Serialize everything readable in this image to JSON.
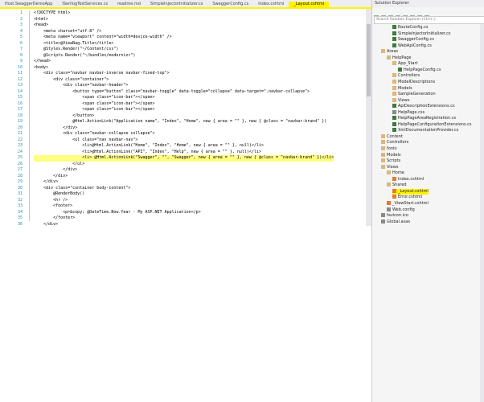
{
  "tabs": [
    "Host.SwaggerDemoApp",
    "ISerilogTestServices.cs",
    "readme.md",
    "SimpleInjectorInitializer.cs",
    "SwaggerConfig.cs",
    "Index.cshtml",
    "_Layout.cshtml"
  ],
  "active_tab": "_Layout.cshtml",
  "code": [
    {
      "n": "1",
      "t": "<!DOCTYPE html>"
    },
    {
      "n": "2",
      "t": "<html>"
    },
    {
      "n": "3",
      "t": "<head>"
    },
    {
      "n": "4",
      "t": "    <meta charset=\"utf-8\" />"
    },
    {
      "n": "5",
      "t": "    <meta name=\"viewport\" content=\"width=device-width\" />"
    },
    {
      "n": "6",
      "t": "    <title>@ViewBag.Title</title>"
    },
    {
      "n": "7",
      "t": "    @Styles.Render(\"~/Content/css\")"
    },
    {
      "n": "8",
      "t": "    @Scripts.Render(\"~/bundles/modernizr\")"
    },
    {
      "n": "9",
      "t": "</head>"
    },
    {
      "n": "10",
      "t": "<body>"
    },
    {
      "n": "11",
      "t": "    <div class=\"navbar navbar-inverse navbar-fixed-top\">"
    },
    {
      "n": "12",
      "t": "        <div class=\"container\">"
    },
    {
      "n": "13",
      "t": "            <div class=\"navbar-header\">"
    },
    {
      "n": "14",
      "t": "                <button type=\"button\" class=\"navbar-toggle\" data-toggle=\"collapse\" data-target=\".navbar-collapse\">"
    },
    {
      "n": "15",
      "t": "                    <span class=\"icon-bar\"></span>"
    },
    {
      "n": "16",
      "t": "                    <span class=\"icon-bar\"></span>"
    },
    {
      "n": "17",
      "t": "                    <span class=\"icon-bar\"></span>"
    },
    {
      "n": "18",
      "t": "                </button>"
    },
    {
      "n": "19",
      "t": "                @Html.ActionLink(\"Application name\", \"Index\", \"Home\", new { area = \"\" }, new { @class = \"navbar-brand\" })"
    },
    {
      "n": "20",
      "t": "            </div>"
    },
    {
      "n": "21",
      "t": "            <div class=\"navbar-collapse collapse\">"
    },
    {
      "n": "22",
      "t": "                <ul class=\"nav navbar-nav\">"
    },
    {
      "n": "23",
      "t": "                    <li>@Html.ActionLink(\"Home\", \"Index\", \"Home\", new { area = \"\" }, null)</li>"
    },
    {
      "n": "24",
      "t": "                    <li>@Html.ActionLink(\"API\", \"Index\", \"Help\", new { area = \"\" }, null)</li>"
    },
    {
      "n": "25",
      "t": "                    <li> @Html.ActionLink(\"Swagger\", \"\", \"Swagger\", new { area = \"\" }, new { @class = \"navbar-brand\" })</li>",
      "hl": true
    },
    {
      "n": "26",
      "t": "                </ul>"
    },
    {
      "n": "27",
      "t": "            </div>"
    },
    {
      "n": "28",
      "t": "        </div>"
    },
    {
      "n": "29",
      "t": "    </div>"
    },
    {
      "n": "30",
      "t": "    <div class=\"container body-content\">"
    },
    {
      "n": "31",
      "t": "        @RenderBody()"
    },
    {
      "n": "32",
      "t": "        <hr />"
    },
    {
      "n": "33",
      "t": "        <footer>"
    },
    {
      "n": "34",
      "t": "            <p>&copy; @DateTime.Now.Year - My ASP.NET Application</p>"
    },
    {
      "n": "35",
      "t": "        </footer>"
    },
    {
      "n": "36",
      "t": "    </div>"
    }
  ],
  "solution_explorer": {
    "title": "Solution Explorer",
    "search_placeholder": "Search Solution Explorer (Ctrl+;)",
    "items": [
      {
        "label": "RouteConfig.cs",
        "icon": "cs",
        "indent": 3
      },
      {
        "label": "SimpleInjectorInitializer.cs",
        "icon": "cs",
        "indent": 3
      },
      {
        "label": "SwaggerConfig.cs",
        "icon": "cs",
        "indent": 3
      },
      {
        "label": "WebApiConfig.cs",
        "icon": "cs",
        "indent": 3
      },
      {
        "label": "Areas",
        "icon": "folder",
        "indent": 1
      },
      {
        "label": "HelpPage",
        "icon": "folder",
        "indent": 2
      },
      {
        "label": "App_Start",
        "icon": "folder",
        "indent": 3
      },
      {
        "label": "HelpPageConfig.cs",
        "icon": "cs",
        "indent": 4
      },
      {
        "label": "Controllers",
        "icon": "folder",
        "indent": 3
      },
      {
        "label": "ModelDescriptions",
        "icon": "folder",
        "indent": 3
      },
      {
        "label": "Models",
        "icon": "folder",
        "indent": 3
      },
      {
        "label": "SampleGeneration",
        "icon": "folder",
        "indent": 3
      },
      {
        "label": "Views",
        "icon": "folder",
        "indent": 3
      },
      {
        "label": "ApiDescriptionExtensions.cs",
        "icon": "cs",
        "indent": 3
      },
      {
        "label": "HelpPage.css",
        "icon": "file",
        "indent": 3
      },
      {
        "label": "HelpPageAreaRegistration.cs",
        "icon": "cs",
        "indent": 3
      },
      {
        "label": "HelpPageConfigurationExtensions.cs",
        "icon": "cs",
        "indent": 3
      },
      {
        "label": "XmlDocumentationProvider.cs",
        "icon": "cs",
        "indent": 3
      },
      {
        "label": "Content",
        "icon": "folder",
        "indent": 1
      },
      {
        "label": "Controllers",
        "icon": "folder",
        "indent": 1
      },
      {
        "label": "fonts",
        "icon": "folder",
        "indent": 1
      },
      {
        "label": "Models",
        "icon": "folder",
        "indent": 1
      },
      {
        "label": "Scripts",
        "icon": "folder",
        "indent": 1
      },
      {
        "label": "Views",
        "icon": "folder",
        "indent": 1
      },
      {
        "label": "Home",
        "icon": "folder",
        "indent": 2
      },
      {
        "label": "Index.cshtml",
        "icon": "html",
        "indent": 3
      },
      {
        "label": "Shared",
        "icon": "folder",
        "indent": 2
      },
      {
        "label": "_Layout.cshtml",
        "icon": "html",
        "indent": 3,
        "selected": true
      },
      {
        "label": "Error.cshtml",
        "icon": "html",
        "indent": 3
      },
      {
        "label": "_ViewStart.cshtml",
        "icon": "html",
        "indent": 2
      },
      {
        "label": "Web.config",
        "icon": "file",
        "indent": 2
      },
      {
        "label": "favicon.ico",
        "icon": "file",
        "indent": 1
      },
      {
        "label": "Global.asax",
        "icon": "file",
        "indent": 1
      }
    ]
  },
  "colors": {
    "highlight": "#fff200",
    "line_number": "#2b91af"
  }
}
